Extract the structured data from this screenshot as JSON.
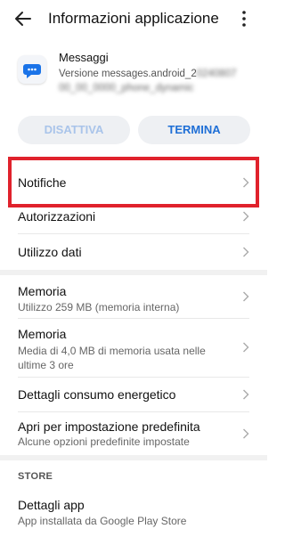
{
  "header": {
    "title": "Informazioni applicazione"
  },
  "app": {
    "name": "Messaggi",
    "version_prefix": "Versione messages.android_2",
    "version_blurred": "0240807",
    "version_line2_blurred": "00_00_0000_phone_dynamic"
  },
  "actions": {
    "disable_label": "DISATTIVA",
    "stop_label": "TERMINA"
  },
  "settings": {
    "notifications": {
      "label": "Notifiche"
    },
    "permissions": {
      "label": "Autorizzazioni"
    },
    "data_usage": {
      "label": "Utilizzo dati"
    },
    "storage": {
      "label": "Memoria",
      "subtitle": "Utilizzo 259 MB (memoria interna)"
    },
    "memory": {
      "label": "Memoria",
      "subtitle": "Media di 4,0 MB di memoria usata nelle ultime 3 ore"
    },
    "power": {
      "label": "Dettagli consumo energetico"
    },
    "defaults": {
      "label": "Apri per impostazione predefinita",
      "subtitle": "Alcune opzioni predefinite impostate"
    }
  },
  "store": {
    "header": "STORE",
    "details": {
      "label": "Dettagli app",
      "subtitle": "App installata da Google Play Store"
    }
  },
  "colors": {
    "accent": "#1f6fd6",
    "highlight": "#e0222c",
    "disabled_text": "#a9c4ea"
  }
}
